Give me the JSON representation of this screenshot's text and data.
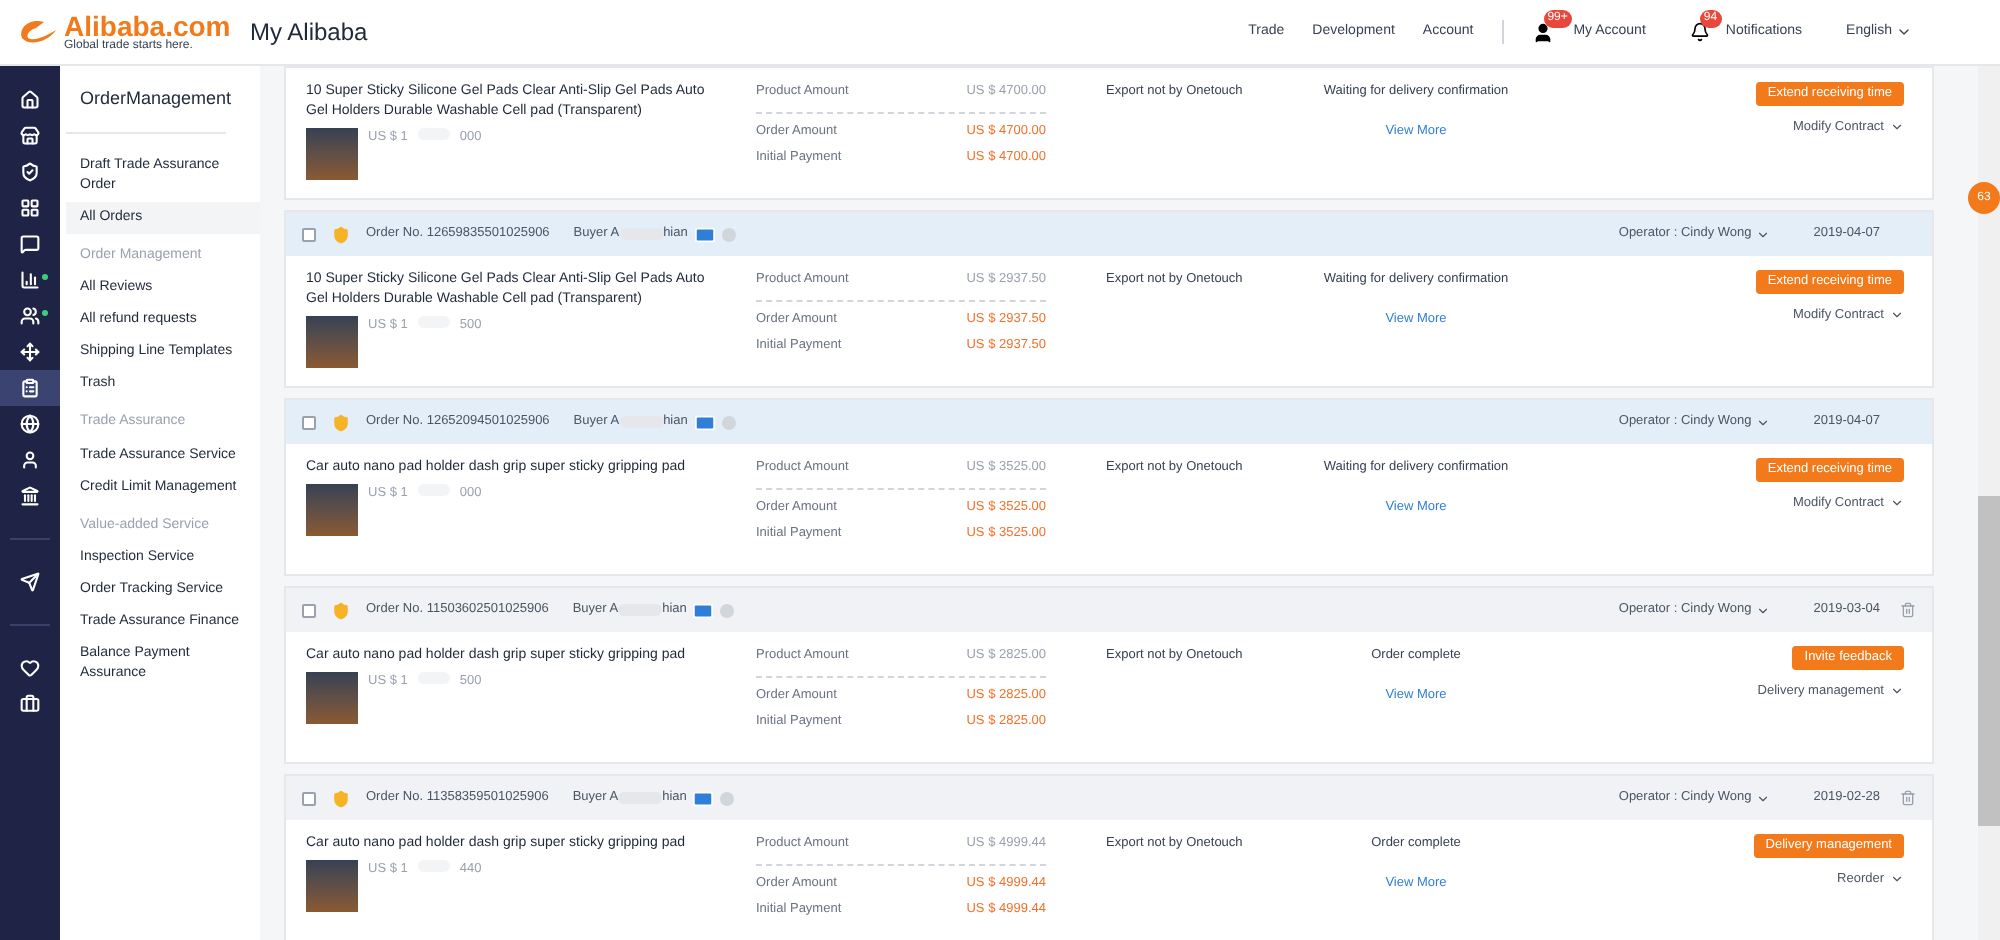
{
  "header": {
    "logo": "Alibaba.com",
    "tagline": "Global trade starts here.",
    "title": "My Alibaba",
    "nav": [
      "Trade",
      "Development",
      "Account"
    ],
    "account": {
      "label": "My Account",
      "badge": "99+"
    },
    "notifications": {
      "label": "Notifications",
      "badge": "94"
    },
    "language": "English"
  },
  "rail": [
    {
      "selected": false,
      "dot": false
    },
    {
      "selected": false,
      "dot": false
    },
    {
      "selected": false,
      "dot": false
    },
    {
      "selected": false,
      "dot": false
    },
    {
      "selected": false,
      "dot": false
    },
    {
      "selected": false,
      "dot": true
    },
    {
      "selected": false,
      "dot": true
    },
    {
      "selected": false,
      "dot": false
    },
    {
      "selected": true,
      "dot": false
    },
    {
      "selected": false,
      "dot": false
    },
    {
      "selected": false,
      "dot": false
    },
    {
      "selected": false,
      "dot": false
    },
    {
      "selected": false,
      "dot": false
    },
    {
      "selected": false,
      "dot": false
    },
    {
      "selected": false,
      "dot": false
    }
  ],
  "sidebar": {
    "title": "OrderManagement",
    "items": [
      {
        "kind": "item",
        "label": "Draft Trade Assurance Order",
        "selected": false
      },
      {
        "kind": "item",
        "label": "All Orders",
        "selected": true
      },
      {
        "kind": "heading",
        "label": "Order Management"
      },
      {
        "kind": "item",
        "label": "All Reviews",
        "selected": false
      },
      {
        "kind": "item",
        "label": "All refund requests",
        "selected": false
      },
      {
        "kind": "item",
        "label": "Shipping Line Templates",
        "selected": false
      },
      {
        "kind": "item",
        "label": "Trash",
        "selected": false
      },
      {
        "kind": "heading",
        "label": "Trade Assurance"
      },
      {
        "kind": "item",
        "label": "Trade Assurance Service",
        "selected": false
      },
      {
        "kind": "item",
        "label": "Credit Limit Management",
        "selected": false
      },
      {
        "kind": "heading",
        "label": "Value-added Service"
      },
      {
        "kind": "item",
        "label": "Inspection Service",
        "selected": false
      },
      {
        "kind": "item",
        "label": "Order Tracking Service",
        "selected": false
      },
      {
        "kind": "item",
        "label": "Trade Assurance Finance",
        "selected": false
      },
      {
        "kind": "item",
        "label": "Balance Payment Assurance",
        "selected": false
      }
    ]
  },
  "orders": [
    {
      "title": "10 Super Sticky Silicone Gel Pads Clear Anti-Slip Gel Pads Auto Gel Holders Durable Washable Cell pad (Transparent)",
      "price_start": "US $ 1",
      "price_end": "000",
      "product_amount_label": "Product Amount",
      "product_amount": "US $ 4700.00",
      "order_amount_label": "Order Amount",
      "order_amount": "US $ 4700.00",
      "payment_label": "Initial Payment",
      "payment": "US $ 4700.00",
      "export": "Export not by Onetouch",
      "status": "Waiting for delivery confirmation",
      "view_more": "View More",
      "primary_action": "Extend receiving time",
      "secondary_action": "Modify Contract"
    },
    {
      "order_no": "Order No. 12659835501025906",
      "buyer_start": "Buyer A",
      "buyer_end": "hian",
      "highlighted": true,
      "operator": "Operator : Cindy Wong",
      "date": "2019-04-07",
      "deletable": false,
      "checked": false,
      "title": "10 Super Sticky Silicone Gel Pads Clear Anti-Slip Gel Pads Auto Gel Holders Durable Washable Cell pad (Transparent)",
      "price_start": "US $ 1",
      "price_end": "500",
      "product_amount_label": "Product Amount",
      "product_amount": "US $ 2937.50",
      "order_amount_label": "Order Amount",
      "order_amount": "US $ 2937.50",
      "payment_label": "Initial Payment",
      "payment": "US $ 2937.50",
      "export": "Export not by Onetouch",
      "status": "Waiting for delivery confirmation",
      "view_more": "View More",
      "primary_action": "Extend receiving time",
      "secondary_action": "Modify Contract"
    },
    {
      "order_no": "Order No. 12652094501025906",
      "buyer_start": "Buyer A",
      "buyer_end": "hian",
      "highlighted": true,
      "operator": "Operator : Cindy Wong",
      "date": "2019-04-07",
      "deletable": false,
      "checked": false,
      "title": "Car auto nano pad holder dash grip super sticky gripping pad",
      "price_start": "US $ 1",
      "price_end": "000",
      "product_amount_label": "Product Amount",
      "product_amount": "US $ 3525.00",
      "order_amount_label": "Order Amount",
      "order_amount": "US $ 3525.00",
      "payment_label": "Initial Payment",
      "payment": "US $ 3525.00",
      "export": "Export not by Onetouch",
      "status": "Waiting for delivery confirmation",
      "view_more": "View More",
      "primary_action": "Extend receiving time",
      "secondary_action": "Modify Contract"
    },
    {
      "order_no": "Order No. 11503602501025906",
      "buyer_start": "Buyer A",
      "buyer_end": "hian",
      "highlighted": false,
      "operator": "Operator : Cindy Wong",
      "date": "2019-03-04",
      "deletable": true,
      "checked": false,
      "title": "Car auto nano pad holder dash grip super sticky gripping pad",
      "price_start": "US $ 1",
      "price_end": "500",
      "product_amount_label": "Product Amount",
      "product_amount": "US $ 2825.00",
      "order_amount_label": "Order Amount",
      "order_amount": "US $ 2825.00",
      "payment_label": "Initial Payment",
      "payment": "US $ 2825.00",
      "export": "Export not by Onetouch",
      "status": "Order complete",
      "view_more": "View More",
      "primary_action": "Invite feedback",
      "secondary_action": "Delivery management"
    },
    {
      "order_no": "Order No. 11358359501025906",
      "buyer_start": "Buyer A",
      "buyer_end": "hian",
      "highlighted": false,
      "operator": "Operator : Cindy Wong",
      "date": "2019-02-28",
      "deletable": true,
      "checked": false,
      "title": "Car auto nano pad holder dash grip super sticky gripping pad",
      "price_start": "US $ 1",
      "price_end": "440",
      "product_amount_label": "Product Amount",
      "product_amount": "US $ 4999.44",
      "order_amount_label": "Order Amount",
      "order_amount": "US $ 4999.44",
      "payment_label": "Initial Payment",
      "payment": "US $ 4999.44",
      "export": "Export not by Onetouch",
      "status": "Order complete",
      "view_more": "View More",
      "primary_action": "Delivery management",
      "secondary_action": "Reorder"
    }
  ],
  "float_badge": "63"
}
